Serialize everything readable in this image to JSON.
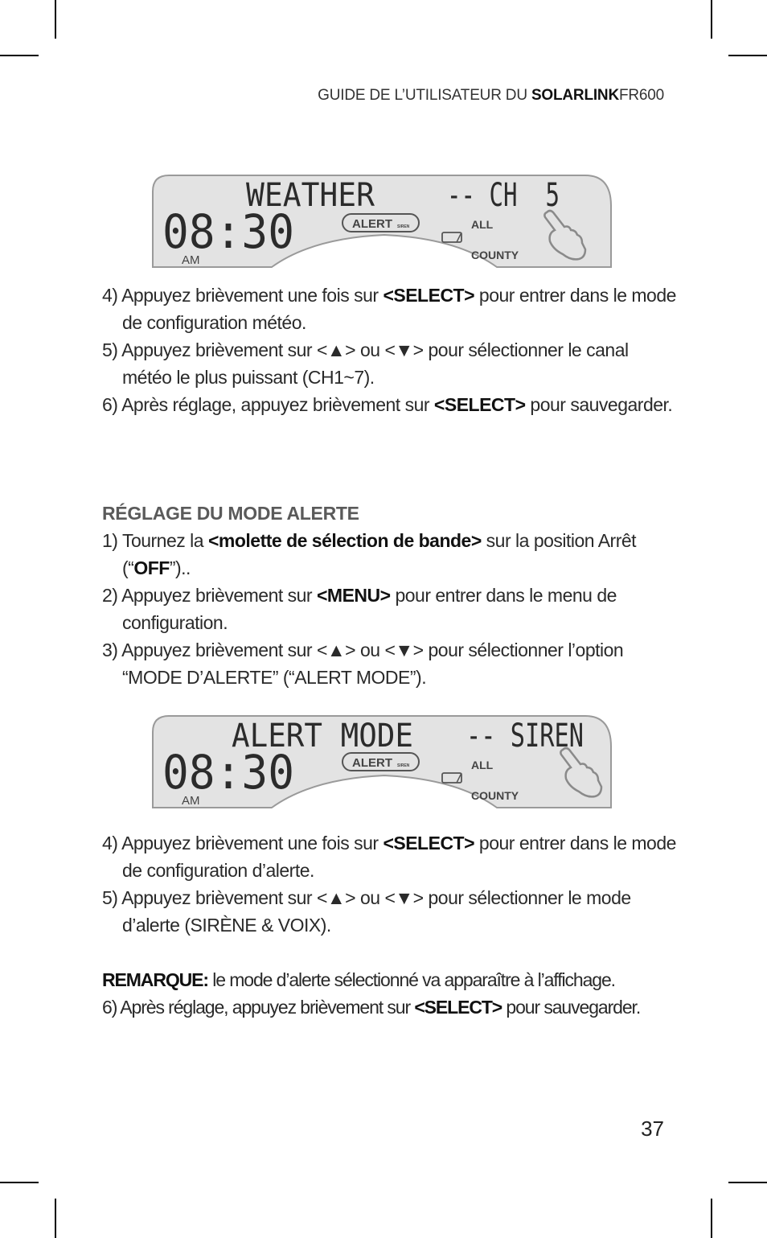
{
  "header": {
    "prefix": "GUIDE DE L’UTILISATEUR DU ",
    "brand": "SOLARLINK",
    "model": "FR600"
  },
  "lcd_displays": [
    {
      "top_text": "WEATHER",
      "right_text": "-- CH  5",
      "time": "08:30",
      "am_pm": "AM",
      "alert_badge": "ALERT",
      "alert_sub": "SIREN",
      "all_label": "ALL",
      "county_label": "COUNTY",
      "icon": "pointing-hand-icon"
    },
    {
      "top_text": "ALERT MODE",
      "right_text": "-- SIREN",
      "time": "08:30",
      "am_pm": "AM",
      "alert_badge": "ALERT",
      "alert_sub": "SIREN",
      "all_label": "ALL",
      "county_label": "COUNTY",
      "icon": "pointing-hand-icon"
    }
  ],
  "section1": {
    "steps": [
      {
        "num": "4) ",
        "pre": "Appuyez brièvement une fois sur ",
        "bold": "<SELECT>",
        "post": " pour entrer dans le mode de configuration météo."
      },
      {
        "num": "5) ",
        "pre": "Appuyez brièvement sur <▲> ou <▼> pour sélectionner le canal météo le plus puissant (CH1~7).",
        "bold": "",
        "post": ""
      },
      {
        "num": "6) ",
        "pre": "Après réglage, appuyez brièvement sur ",
        "bold": "<SELECT>",
        "post": " pour sauvegarder."
      }
    ]
  },
  "section2": {
    "heading": "RÉGLAGE DU MODE ALERTE",
    "steps": [
      {
        "num": "1) ",
        "pre": "Tournez la ",
        "bold": "<molette de sélection de bande>",
        "mid": " sur la position Arrêt (“",
        "bold2": "OFF",
        "post": "”).."
      },
      {
        "num": "2) ",
        "pre": "Appuyez brièvement sur ",
        "bold": "<MENU>",
        "post": " pour entrer dans le menu de configuration."
      },
      {
        "num": "3) ",
        "pre": "Appuyez brièvement sur  <▲> ou <▼> pour sélectionner l’option “MODE D’ALERTE” (“ALERT MODE”).",
        "bold": "",
        "post": ""
      }
    ]
  },
  "section3": {
    "steps": [
      {
        "num": "4) ",
        "pre": "Appuyez brièvement une fois sur ",
        "bold": "<SELECT>",
        "post": " pour entrer dans le mode de configuration d’alerte."
      },
      {
        "num": "5) ",
        "pre": "Appuyez brièvement sur  <▲> ou <▼> pour sélectionner le mode d’alerte (SIRÈNE & VOIX).",
        "bold": "",
        "post": ""
      }
    ],
    "note_label": "REMARQUE:",
    "note_text": " le mode d’alerte sélectionné va apparaître à l’affichage.",
    "final_step": {
      "num": "6) ",
      "pre": "Après réglage, appuyez brièvement sur ",
      "bold": "<SELECT>",
      "post": " pour sauvegarder."
    }
  },
  "page_number": "37"
}
